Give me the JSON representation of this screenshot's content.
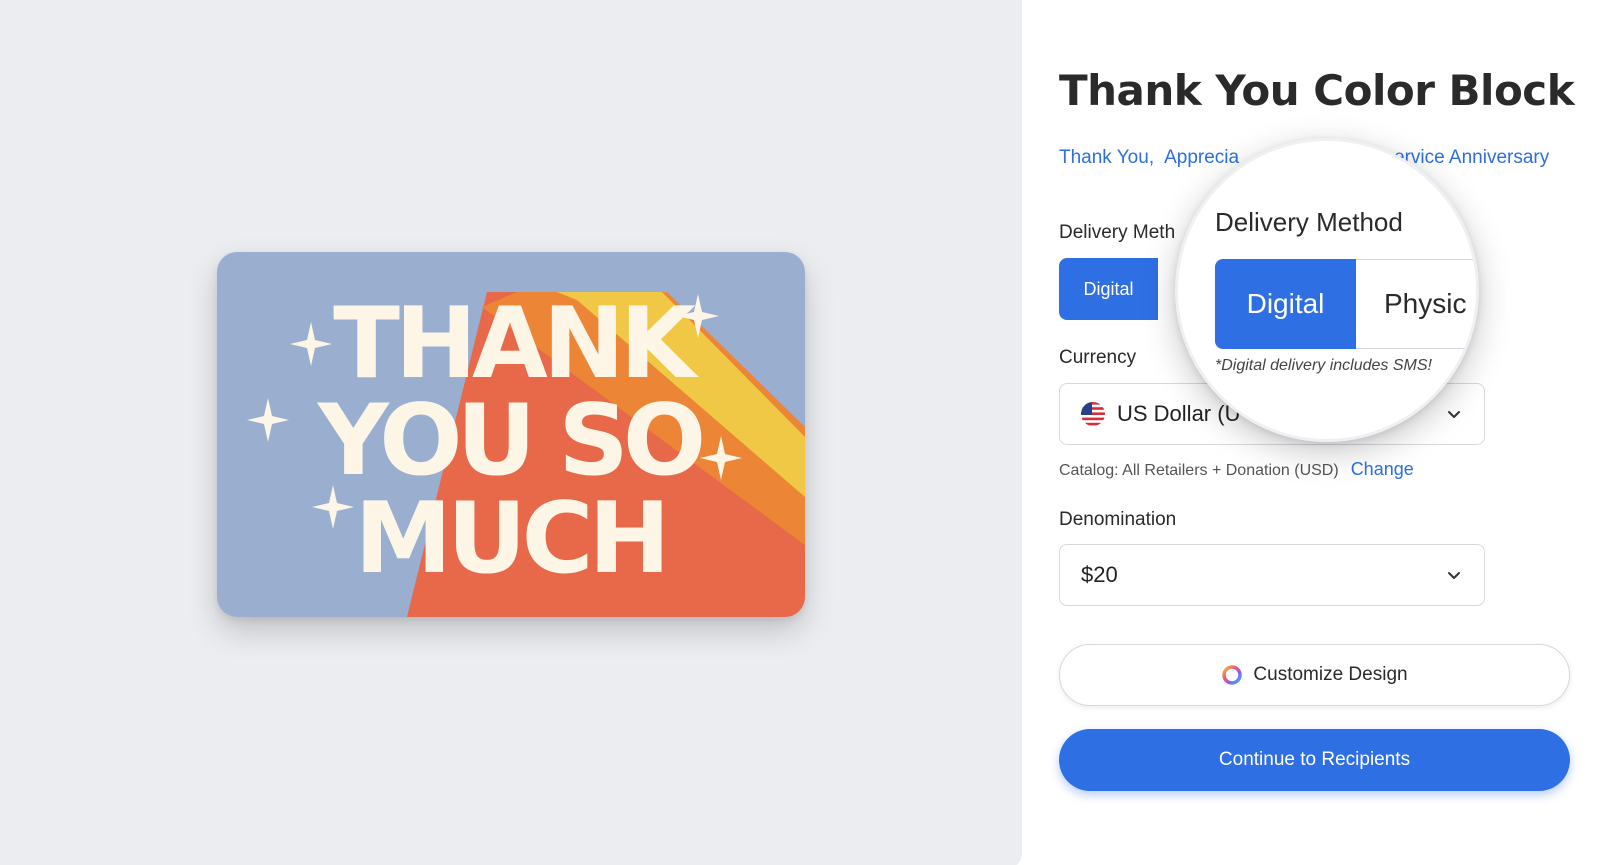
{
  "product": {
    "title": "Thank You Color Block",
    "tags": [
      "Thank You",
      "Apprecia",
      "ervice Anniversary"
    ],
    "tag_separator": ","
  },
  "card": {
    "line1": "THANK",
    "line2": "YOU SO",
    "line3": "MUCH",
    "colors": {
      "background": "#9aaed0",
      "band_yellow": "#f0c846",
      "band_orange": "#ed8536",
      "band_red": "#e8684a",
      "text": "#fdf6e7"
    }
  },
  "delivery": {
    "label": "Delivery Meth",
    "selected_option": "Digital"
  },
  "magnifier": {
    "title": "Delivery Method",
    "options": [
      "Digital",
      "Physic"
    ],
    "selected": "Digital",
    "note": "*Digital delivery includes SMS!"
  },
  "currency": {
    "label": "Currency",
    "selected": "US Dollar (U",
    "flag_icon": "us-flag-icon",
    "catalog_text": "Catalog: All Retailers + Donation (USD)",
    "change_label": "Change"
  },
  "denomination": {
    "label": "Denomination",
    "selected": "$20"
  },
  "actions": {
    "customize_label": "Customize Design",
    "continue_label": "Continue to Recipients"
  },
  "colors": {
    "accent": "#2f6fe4",
    "link": "#2d6fe0",
    "preview_bg": "#ecedf1"
  }
}
